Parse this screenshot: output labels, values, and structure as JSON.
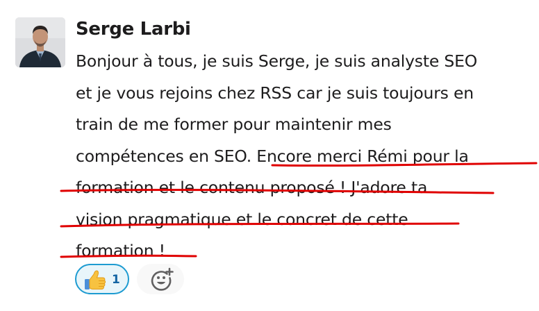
{
  "message": {
    "author": "Serge Larbi",
    "lines": [
      "Bonjour à tous, je suis Serge, je suis analyste SEO",
      "et je vous rejoins chez RSS car je suis toujours en",
      "train de me former pour maintenir mes",
      "compétences en SEO. Encore merci Rémi pour la",
      "formation et le contenu proposé ! J'adore ta",
      "vision pragmatique et le concret de cette",
      "formation !"
    ]
  },
  "reactions": [
    {
      "emoji": "thumbs-up-icon",
      "count": "1",
      "selected": true
    }
  ],
  "add_reaction": {
    "icon": "add-reaction-icon"
  },
  "colors": {
    "text": "#1d1c1d",
    "reaction_border": "#1d9bd1",
    "reaction_bg": "#e8f5fa",
    "reaction_count": "#1264a3",
    "underline": "#e00000",
    "add_reaction_bg": "#f8f8f8"
  }
}
